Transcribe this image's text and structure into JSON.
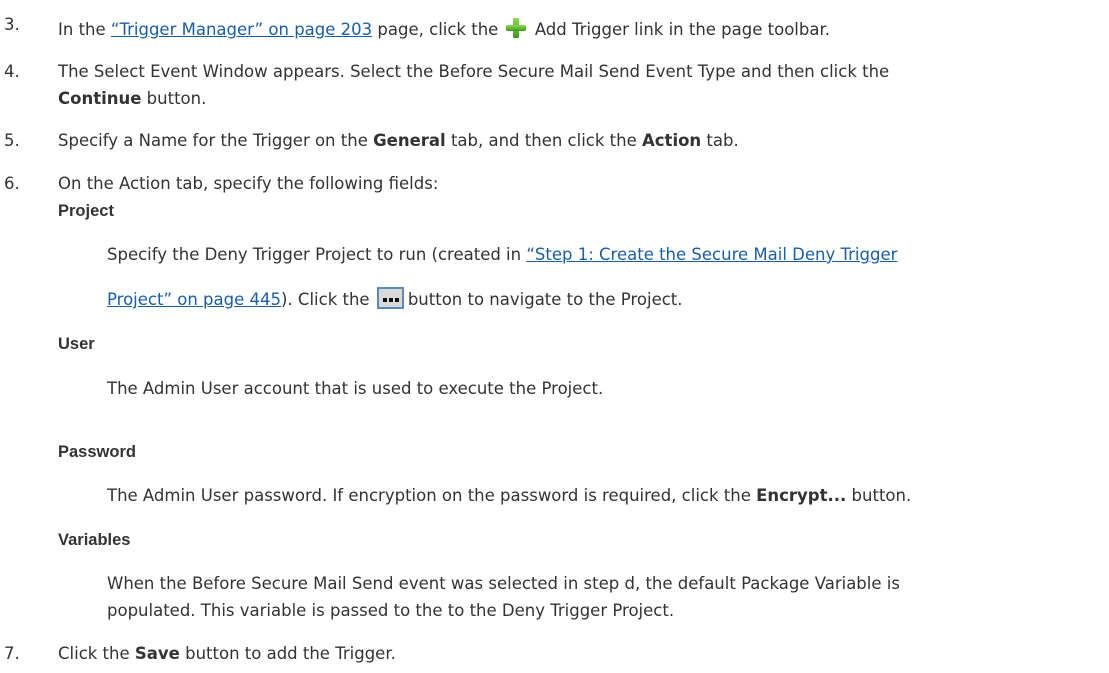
{
  "steps": [
    {
      "number": "3.",
      "pre": "In the ",
      "link": "“Trigger Manager” on page 203",
      "mid": " page, click the",
      "after_icon": "Add Trigger link in the page toolbar."
    },
    {
      "number": "4.",
      "line1": "The Select Event Window appears. Select the Before Secure Mail Send Event Type and then click the",
      "bold": "Continue",
      "rest": " button."
    },
    {
      "number": "5.",
      "pre": "Specify a Name for the Trigger on the ",
      "bold1": "General",
      "mid": " tab, and then click the ",
      "bold2": "Action",
      "post": " tab."
    },
    {
      "number": "6.",
      "text": "On the Action tab, specify the following fields:"
    },
    {
      "number": "7.",
      "pre": "Click the ",
      "bold": "Save",
      "post": " button to add the Trigger."
    }
  ],
  "fields": {
    "project": {
      "term": "Project",
      "pre": "Specify the Deny Trigger Project to run (created in ",
      "link_line1": "“Step 1: Create the Secure Mail Deny Trigger",
      "link_line2": "Project” on page 445",
      "mid": "). Click the",
      "post": "button to navigate to the Project."
    },
    "user": {
      "term": "User",
      "text": "The Admin User account that is used to execute the Project."
    },
    "password": {
      "term": "Password",
      "pre": "The Admin User password. If encryption on the password is required, click the ",
      "bold": "Encrypt...",
      "post": " button."
    },
    "variables": {
      "term": "Variables",
      "line1": "When the Before Secure Mail Send event was selected in step d, the default Package Variable is",
      "line2": "populated. This variable is passed to the to the Deny Trigger Project."
    }
  },
  "icons": {
    "add": "plus-icon",
    "browse": "browse-icon",
    "add_color": "#4fb52a",
    "browse_border": "#5a88bf"
  },
  "colors": {
    "text": "#333333",
    "link": "#1a5ea8"
  }
}
